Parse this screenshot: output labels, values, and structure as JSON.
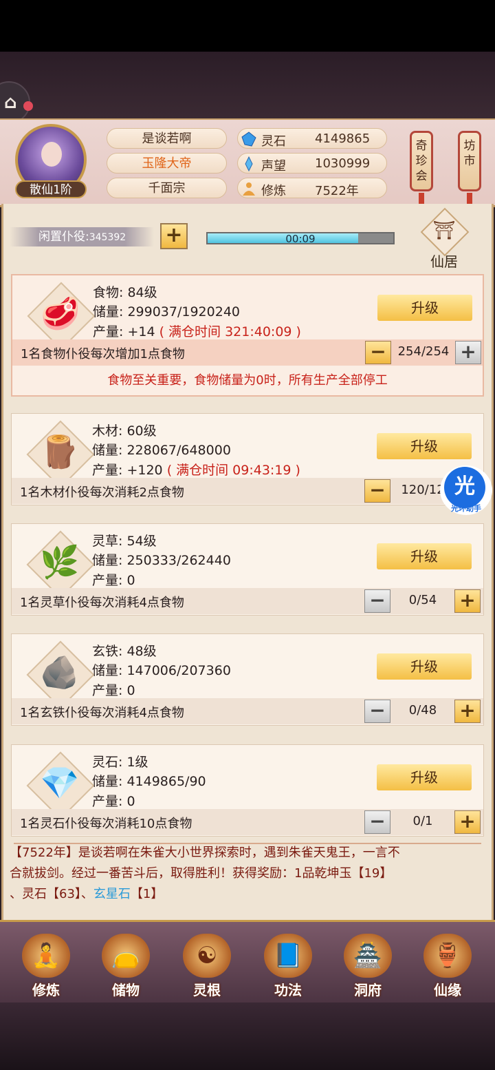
{
  "logo_glyph": "⌂",
  "header": {
    "rank": "散仙1阶",
    "name": "是谈若啊",
    "title": "玉隆大帝",
    "sect": "千面宗",
    "stats": [
      {
        "icon": "spirit-stone-icon",
        "label": "灵石",
        "value": "4149865"
      },
      {
        "icon": "reputation-icon",
        "label": "声望",
        "value": "1030999"
      },
      {
        "icon": "cultivation-icon",
        "label": "修炼",
        "value": "7522年"
      }
    ],
    "side_buttons": [
      "奇珍会",
      "坊市"
    ]
  },
  "idle": {
    "label": "闲置仆役:",
    "value": "345392",
    "plus": "+"
  },
  "timer": {
    "text": "00:09",
    "progress": 0.81
  },
  "residence_label": "仙居",
  "resources": [
    {
      "name": "食物",
      "level_text": "食物: 84级",
      "storage_text": "储量: 299037/1920240",
      "output": "产量: +14",
      "full_time": "( 满仓时间 321:40:09 )",
      "desc": "1名食物仆役每次增加1点食物",
      "count": "254/254",
      "upgrade": "升级",
      "symbol": "🥩"
    },
    {
      "name": "木材",
      "level_text": "木材: 60级",
      "storage_text": "储量: 228067/648000",
      "output": "产量: +120",
      "full_time": "( 满仓时间 09:43:19 )",
      "desc": "1名木材仆役每次消耗2点食物",
      "count": "120/12",
      "upgrade": "升级",
      "symbol": "🪵"
    },
    {
      "name": "灵草",
      "level_text": "灵草: 54级",
      "storage_text": "储量: 250333/262440",
      "output": "产量: 0",
      "full_time": "",
      "desc": "1名灵草仆役每次消耗4点食物",
      "count": "0/54",
      "upgrade": "升级",
      "symbol": "🌿"
    },
    {
      "name": "玄铁",
      "level_text": "玄铁: 48级",
      "storage_text": "储量: 147006/207360",
      "output": "产量: 0",
      "full_time": "",
      "desc": "1名玄铁仆役每次消耗4点食物",
      "count": "0/48",
      "upgrade": "升级",
      "symbol": "🪨"
    },
    {
      "name": "灵石",
      "level_text": "灵石: 1级",
      "storage_text": "储量: 4149865/90",
      "output": "产量: 0",
      "full_time": "",
      "desc": "1名灵石仆役每次消耗10点食物",
      "count": "0/1",
      "upgrade": "升级",
      "symbol": "💎"
    }
  ],
  "food_warning": "食物至关重要，食物储量为0时，所有生产全部停工",
  "helper": {
    "glyph": "光",
    "label": "光环助手"
  },
  "log": {
    "line1": "【7522年】是谈若啊在朱雀大小世界探索时，遇到朱雀天鬼王，一言不",
    "line2": "合就拔剑。经过一番苦斗后，取得胜利！获得奖励：1品乾坤玉【19】",
    "line3_a": "、灵石【63】、",
    "line3_b": "玄星石",
    "line3_c": "【1】"
  },
  "nav": [
    {
      "label": "修炼",
      "icon": "cultivate-icon",
      "glyph": "🧘"
    },
    {
      "label": "储物",
      "icon": "storage-bag-icon",
      "glyph": "👝"
    },
    {
      "label": "灵根",
      "icon": "spirit-root-icon",
      "glyph": "☯"
    },
    {
      "label": "功法",
      "icon": "technique-book-icon",
      "glyph": "📘"
    },
    {
      "label": "洞府",
      "icon": "cave-dwelling-icon",
      "glyph": "🏯"
    },
    {
      "label": "仙缘",
      "icon": "fate-gourd-icon",
      "glyph": "🏺"
    }
  ]
}
